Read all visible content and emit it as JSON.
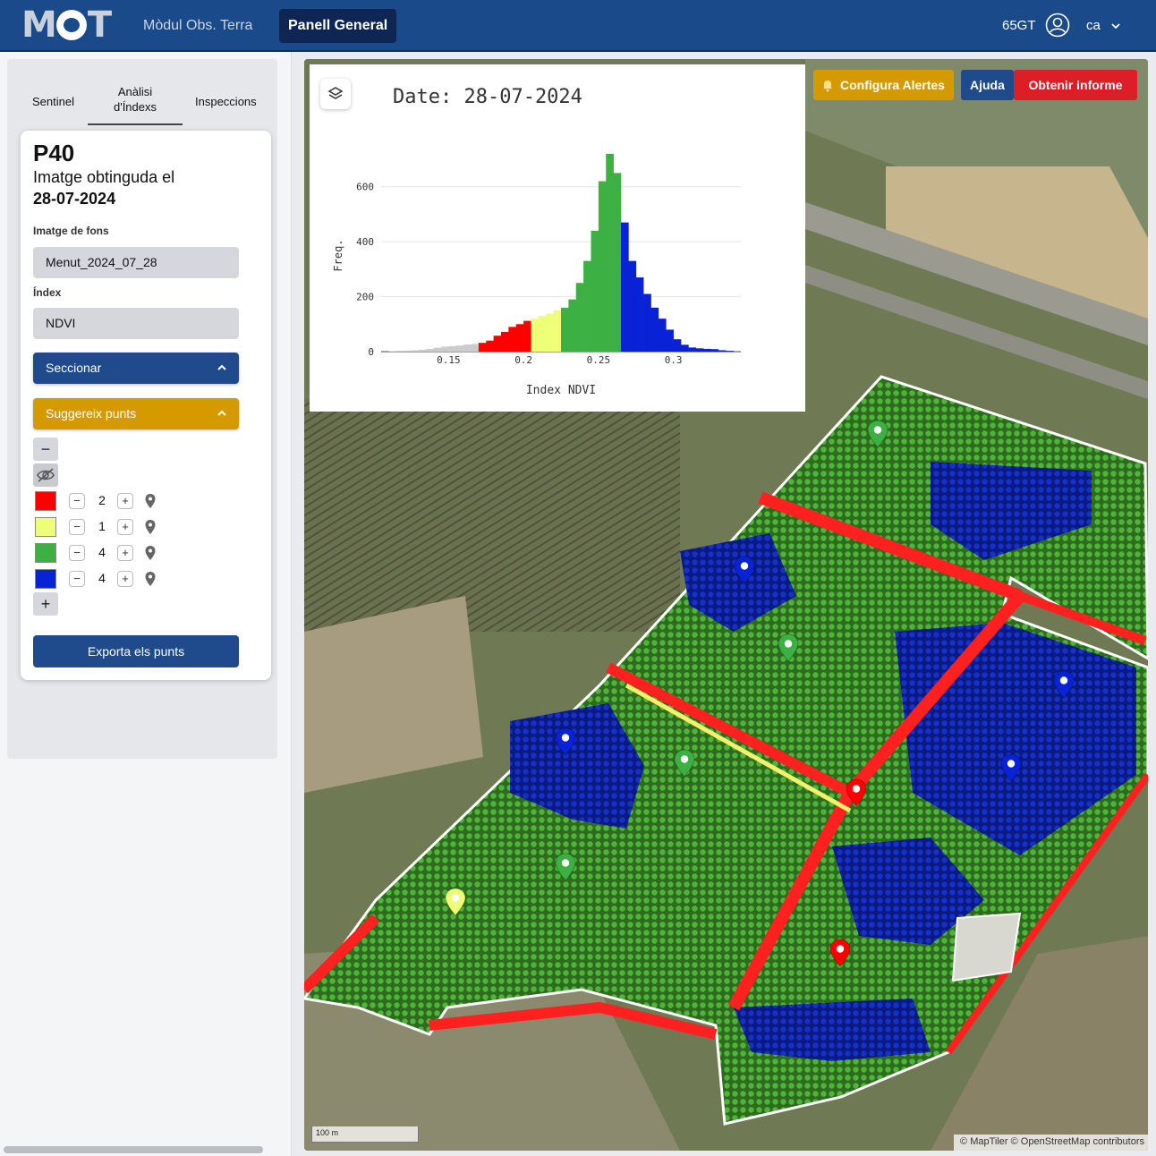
{
  "app": {
    "logo_text": "MOT",
    "nav": {
      "obs_label": "Mòdul Obs. Terra",
      "panel_label": "Panell General"
    },
    "user": {
      "name": "65GT",
      "lang": "ca"
    }
  },
  "sidebar": {
    "tabs": [
      {
        "label": "Sentinel"
      },
      {
        "label_line1": "Anàlisi",
        "label_line2": "d'Índexs"
      },
      {
        "label": "Inspeccions"
      }
    ],
    "parcel": {
      "title": "P40",
      "subtitle": "Imatge obtinguda el",
      "date": "28-07-2024"
    },
    "background_label": "Imatge de fons",
    "background_value": "Menut_2024_07_28",
    "index_label": "Índex",
    "index_value": "NDVI",
    "section_label": "Seccionar",
    "suggest_label": "Suggereix punts",
    "classes": [
      {
        "color": "#ff0000",
        "count": "2"
      },
      {
        "color": "#eeff77",
        "count": "1"
      },
      {
        "color": "#3cb043",
        "count": "4"
      },
      {
        "color": "#0a22d6",
        "count": "4"
      }
    ],
    "export_label": "Exporta els punts"
  },
  "map": {
    "buttons": {
      "alerts": "Configura Alertes",
      "help": "Ajuda",
      "report": "Obtenir informe"
    },
    "scale_label": "100 m",
    "attribution": "© MapTiler © OpenStreetMap contributors"
  },
  "histogram": {
    "date_label": "Date: 28-07-2024"
  },
  "chart_data": {
    "type": "bar",
    "title": "Date: 28-07-2024",
    "xlabel": "Index NDVI",
    "ylabel": "Freq.",
    "xlim": [
      0.105,
      0.345
    ],
    "ylim": [
      0,
      700
    ],
    "xticks": [
      0.15,
      0.2,
      0.25,
      0.3
    ],
    "yticks": [
      0,
      200,
      400,
      600
    ],
    "bin_start": 0.11,
    "bin_width": 0.005,
    "x": [
      0.1125,
      0.1175,
      0.1225,
      0.1275,
      0.1325,
      0.1375,
      0.1425,
      0.1475,
      0.1525,
      0.1575,
      0.1625,
      0.1675,
      0.1725,
      0.1775,
      0.1825,
      0.1875,
      0.1925,
      0.1975,
      0.2025,
      0.2075,
      0.2125,
      0.2175,
      0.2225,
      0.2275,
      0.2325,
      0.2375,
      0.2425,
      0.2475,
      0.2525,
      0.2575,
      0.2625,
      0.2675,
      0.2725,
      0.2775,
      0.2825,
      0.2875,
      0.2925,
      0.2975,
      0.3025,
      0.3075,
      0.3125,
      0.3175,
      0.3225,
      0.3275,
      0.3325,
      0.3375
    ],
    "values": [
      2,
      3,
      4,
      5,
      7,
      10,
      14,
      18,
      20,
      22,
      26,
      28,
      32,
      40,
      58,
      72,
      90,
      100,
      112,
      120,
      130,
      138,
      150,
      160,
      190,
      250,
      330,
      440,
      620,
      720,
      650,
      470,
      330,
      270,
      210,
      160,
      120,
      80,
      45,
      25,
      15,
      12,
      10,
      9,
      5,
      3
    ],
    "colors": [
      "#cccccc",
      "#cccccc",
      "#cccccc",
      "#cccccc",
      "#cccccc",
      "#cccccc",
      "#cccccc",
      "#cccccc",
      "#cccccc",
      "#cccccc",
      "#cccccc",
      "#cccccc",
      "#ff0000",
      "#ff0000",
      "#ff0000",
      "#ff0000",
      "#ff0000",
      "#ff0000",
      "#ff0000",
      "#eeff77",
      "#eeff77",
      "#eeff77",
      "#eeff77",
      "#3cb043",
      "#3cb043",
      "#3cb043",
      "#3cb043",
      "#3cb043",
      "#3cb043",
      "#3cb043",
      "#3cb043",
      "#0a22d6",
      "#0a22d6",
      "#0a22d6",
      "#0a22d6",
      "#0a22d6",
      "#0a22d6",
      "#0a22d6",
      "#0a22d6",
      "#0a22d6",
      "#0a22d6",
      "#0a22d6",
      "#0a22d6",
      "#0a22d6",
      "#0a22d6",
      "#0a22d6"
    ],
    "grid": true,
    "legend": "none"
  }
}
